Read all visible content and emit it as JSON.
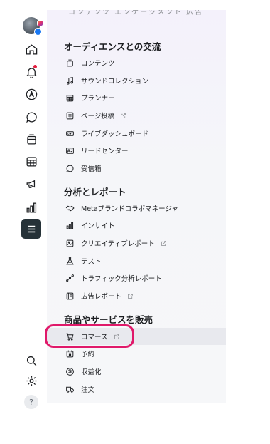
{
  "top_clip": "コンテンツ  エンゲージメント  広告",
  "rail": {
    "icons": [
      "profile-avatar",
      "home-icon",
      "notifications-icon",
      "explore-icon",
      "chat-icon",
      "content-icon",
      "planner-icon",
      "ads-icon",
      "insights-icon",
      "all-tools-icon",
      "search-icon",
      "settings-icon",
      "help-icon"
    ],
    "help_label": "?"
  },
  "sections": [
    {
      "title": "オーディエンスとの交流",
      "items": [
        {
          "label": "コンテンツ",
          "icon": "content-icon",
          "external": false
        },
        {
          "label": "サウンドコレクション",
          "icon": "music-note-icon",
          "external": false
        },
        {
          "label": "プランナー",
          "icon": "calendar-grid-icon",
          "external": false
        },
        {
          "label": "ページ投稿",
          "icon": "page-post-icon",
          "external": true
        },
        {
          "label": "ライブダッシュボード",
          "icon": "live-icon",
          "external": false
        },
        {
          "label": "リードセンター",
          "icon": "contact-card-icon",
          "external": false
        },
        {
          "label": "受信箱",
          "icon": "chat-bubble-icon",
          "external": false
        }
      ]
    },
    {
      "title": "分析とレポート",
      "items": [
        {
          "label": "Metaブランドコラボマネージャ",
          "icon": "handshake-icon",
          "external": false
        },
        {
          "label": "インサイト",
          "icon": "bar-chart-icon",
          "external": false
        },
        {
          "label": "クリエイティブレポート",
          "icon": "image-icon",
          "external": true
        },
        {
          "label": "テスト",
          "icon": "flask-icon",
          "external": false
        },
        {
          "label": "トラフィック分析レポート",
          "icon": "traffic-icon",
          "external": false
        },
        {
          "label": "広告レポート",
          "icon": "report-icon",
          "external": true
        }
      ]
    },
    {
      "title": "商品やサービスを販売",
      "items": [
        {
          "label": "コマース",
          "icon": "cart-icon",
          "external": true
        },
        {
          "label": "予約",
          "icon": "calendar-icon",
          "external": false
        },
        {
          "label": "収益化",
          "icon": "dollar-icon",
          "external": false
        },
        {
          "label": "注文",
          "icon": "delivery-truck-icon",
          "external": false
        }
      ]
    }
  ],
  "colors": {
    "highlight_ring": "#e0196a",
    "active_rail": "#263238",
    "notification_dot": "#e41e3f"
  }
}
